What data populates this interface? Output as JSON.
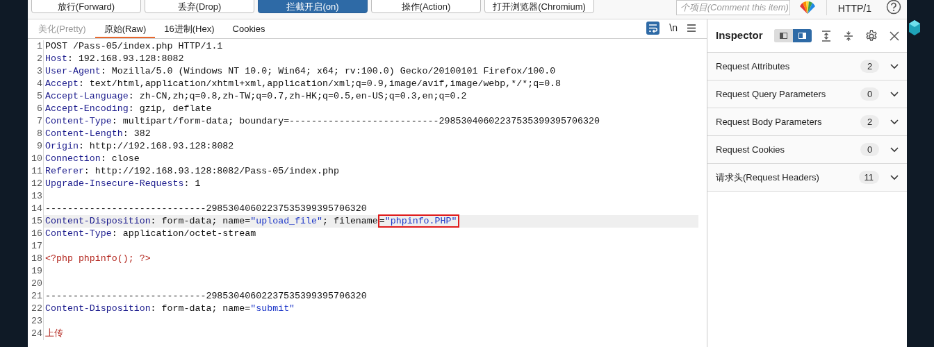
{
  "toolbar": {
    "buttons": [
      {
        "label": "放行(Forward)",
        "selected": false
      },
      {
        "label": "丢弃(Drop)",
        "selected": false
      },
      {
        "label": "拦截开启(on)",
        "selected": true
      },
      {
        "label": "操作(Action)",
        "selected": false
      },
      {
        "label": "打开浏览器(Chromium)",
        "selected": false
      }
    ],
    "comment": {
      "placeholder": "个项目(Comment this item)"
    },
    "protocol": "HTTP/1"
  },
  "editor": {
    "tabs": [
      {
        "label": "美化(Pretty)",
        "selected": false,
        "disabled": true
      },
      {
        "label": "原始(Raw)",
        "selected": true,
        "disabled": false
      },
      {
        "label": "16进制(Hex)",
        "selected": false,
        "disabled": false
      },
      {
        "label": "Cookies",
        "selected": false,
        "disabled": false
      }
    ],
    "wrap_on": true,
    "newline_label": "\\n",
    "lines": [
      {
        "number": "1",
        "highlighted": false,
        "segments": [
          {
            "kind": "plain",
            "text": "POST /Pass-05/index.php HTTP/1.1"
          }
        ]
      },
      {
        "number": "2",
        "highlighted": false,
        "segments": [
          {
            "kind": "name",
            "text": "Host"
          },
          {
            "kind": "plain",
            "text": ": 192.168.93.128:8082"
          }
        ]
      },
      {
        "number": "3",
        "highlighted": false,
        "segments": [
          {
            "kind": "name",
            "text": "User-Agent"
          },
          {
            "kind": "plain",
            "text": ": Mozilla/5.0 (Windows NT 10.0; Win64; x64; rv:100.0) Gecko/20100101 Firefox/100.0"
          }
        ]
      },
      {
        "number": "4",
        "highlighted": false,
        "segments": [
          {
            "kind": "name",
            "text": "Accept"
          },
          {
            "kind": "plain",
            "text": ": text/html,application/xhtml+xml,application/xml;q=0.9,image/avif,image/webp,*/*;q=0.8"
          }
        ]
      },
      {
        "number": "5",
        "highlighted": false,
        "segments": [
          {
            "kind": "name",
            "text": "Accept-Language"
          },
          {
            "kind": "plain",
            "text": ": zh-CN,zh;q=0.8,zh-TW;q=0.7,zh-HK;q=0.5,en-US;q=0.3,en;q=0.2"
          }
        ]
      },
      {
        "number": "6",
        "highlighted": false,
        "segments": [
          {
            "kind": "name",
            "text": "Accept-Encoding"
          },
          {
            "kind": "plain",
            "text": ": gzip, deflate"
          }
        ]
      },
      {
        "number": "7",
        "highlighted": false,
        "segments": [
          {
            "kind": "name",
            "text": "Content-Type"
          },
          {
            "kind": "plain",
            "text": ": multipart/form-data; boundary=---------------------------29853040602237535399395706320"
          }
        ]
      },
      {
        "number": "8",
        "highlighted": false,
        "segments": [
          {
            "kind": "name",
            "text": "Content-Length"
          },
          {
            "kind": "plain",
            "text": ": 382"
          }
        ]
      },
      {
        "number": "9",
        "highlighted": false,
        "segments": [
          {
            "kind": "name",
            "text": "Origin"
          },
          {
            "kind": "plain",
            "text": ": http://192.168.93.128:8082"
          }
        ]
      },
      {
        "number": "10",
        "highlighted": false,
        "segments": [
          {
            "kind": "name",
            "text": "Connection"
          },
          {
            "kind": "plain",
            "text": ": close"
          }
        ]
      },
      {
        "number": "11",
        "highlighted": false,
        "segments": [
          {
            "kind": "name",
            "text": "Referer"
          },
          {
            "kind": "plain",
            "text": ": http://192.168.93.128:8082/Pass-05/index.php"
          }
        ]
      },
      {
        "number": "12",
        "highlighted": false,
        "segments": [
          {
            "kind": "name",
            "text": "Upgrade-Insecure-Requests"
          },
          {
            "kind": "plain",
            "text": ": 1"
          }
        ]
      },
      {
        "number": "13",
        "highlighted": false
      },
      {
        "number": "14",
        "highlighted": false,
        "segments": [
          {
            "kind": "plain",
            "text": "-----------------------------29853040602237535399395706320"
          }
        ]
      },
      {
        "number": "15",
        "highlighted": true,
        "segments": [
          {
            "kind": "name",
            "text": "Content-Disposition"
          },
          {
            "kind": "plain",
            "text": ": form-data; name="
          },
          {
            "kind": "string",
            "text": "\"upload_file\""
          },
          {
            "kind": "plain",
            "text": "; filename"
          },
          {
            "kind": "plain",
            "text": "=",
            "boxed": true
          },
          {
            "kind": "string",
            "text": "\"phpinfo.PHP\"",
            "boxed": true
          }
        ]
      },
      {
        "number": "16",
        "highlighted": false,
        "segments": [
          {
            "kind": "name",
            "text": "Content-Type"
          },
          {
            "kind": "plain",
            "text": ": application/octet-stream"
          }
        ]
      },
      {
        "number": "17",
        "highlighted": false
      },
      {
        "number": "18",
        "highlighted": false,
        "segments": [
          {
            "kind": "code",
            "text": "<?php phpinfo(); ?>"
          }
        ]
      },
      {
        "number": "19",
        "highlighted": false
      },
      {
        "number": "20",
        "highlighted": false
      },
      {
        "number": "21",
        "highlighted": false,
        "segments": [
          {
            "kind": "plain",
            "text": "-----------------------------29853040602237535399395706320"
          }
        ]
      },
      {
        "number": "22",
        "highlighted": false,
        "segments": [
          {
            "kind": "name",
            "text": "Content-Disposition"
          },
          {
            "kind": "plain",
            "text": ": form-data; name="
          },
          {
            "kind": "string",
            "text": "\"submit\""
          }
        ]
      },
      {
        "number": "23",
        "highlighted": false
      },
      {
        "number": "24",
        "highlighted": false,
        "segments": [
          {
            "kind": "code",
            "text": "上传"
          }
        ]
      }
    ]
  },
  "inspector": {
    "title": "Inspector",
    "layout_toggle": [
      {
        "selected": false
      },
      {
        "selected": true
      }
    ],
    "sections": [
      {
        "label": "Request Attributes",
        "count": "2",
        "expanded": false
      },
      {
        "label": "Request Query Parameters",
        "count": "0",
        "expanded": false
      },
      {
        "label": "Request Body Parameters",
        "count": "2",
        "expanded": false
      },
      {
        "label": "Request Cookies",
        "count": "0",
        "expanded": false
      },
      {
        "label": "请求头(Request Headers)",
        "count": "11",
        "expanded": false
      }
    ]
  }
}
